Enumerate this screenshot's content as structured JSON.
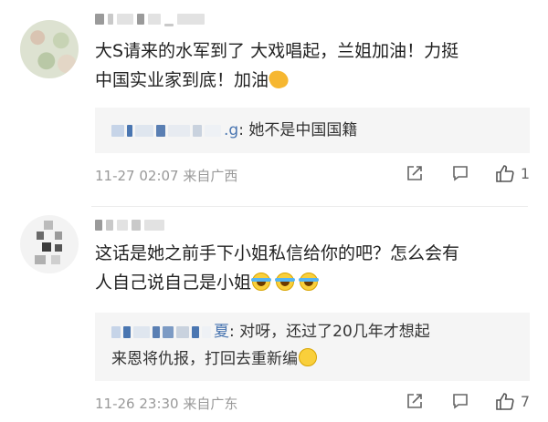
{
  "colors": {
    "reply_name": "#4a76b1",
    "meta": "#999999",
    "reply_bg": "#f5f5f5"
  },
  "comments": [
    {
      "text_line1": "大S请来的水军到了 大戏唱起，兰姐加油！力挺",
      "text_line2": "中国实业家到底！加油",
      "text_emoji": "flexed-biceps-icon",
      "reply_name_suffix": ".g",
      "reply_text": ": 她不是中国国籍",
      "time": "11-27 02:07",
      "location": "来自广西",
      "like_count": "1"
    },
    {
      "text_line1": "这话是她之前手下小姐私信给你的吧？怎么会有",
      "text_line2": "人自己说自己是小姐",
      "text_emoji": "tears-of-joy-icon",
      "reply_name_suffix": "夏",
      "reply_text_line1": ": 对呀，还过了20几年才想起",
      "reply_text_line2": "来恩将仇报，打回去重新编",
      "reply_emoji": "shushing-face-icon",
      "time": "11-26 23:30",
      "location": "来自广东",
      "like_count": "7"
    }
  ]
}
